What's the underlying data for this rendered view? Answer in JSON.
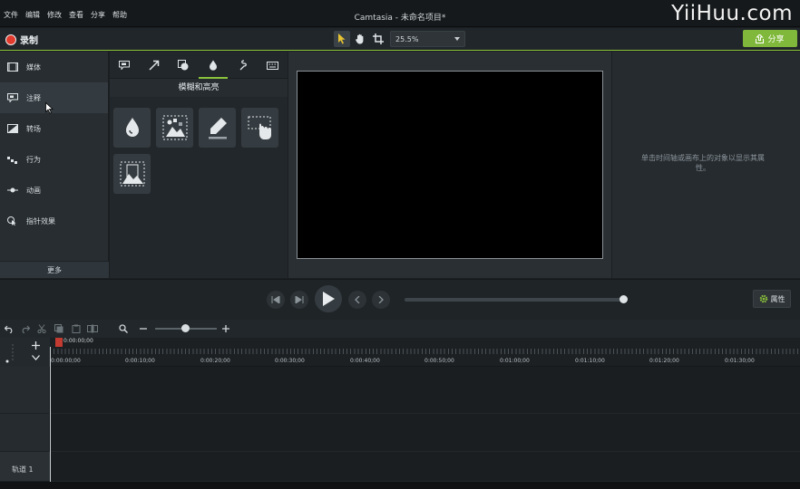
{
  "menu": [
    "文件",
    "编辑",
    "修改",
    "查看",
    "分享",
    "帮助"
  ],
  "app_title": "Camtasia - 未命名项目*",
  "watermark": "YiiHuu.com",
  "toolbar": {
    "record_label": "录制",
    "zoom_value": "25.5%",
    "share_label": "分享"
  },
  "sidebar": {
    "items": [
      {
        "label": "媒体",
        "icon": "film-icon"
      },
      {
        "label": "注释",
        "icon": "annotation-icon"
      },
      {
        "label": "转场",
        "icon": "transition-icon"
      },
      {
        "label": "行为",
        "icon": "behavior-icon"
      },
      {
        "label": "动画",
        "icon": "animation-icon"
      },
      {
        "label": "指针效果",
        "icon": "cursor-effect-icon"
      }
    ],
    "more_label": "更多",
    "active_index": 1
  },
  "panel": {
    "title": "模糊和高亮",
    "tabs": [
      "callout-icon",
      "arrow-icon",
      "shape-icon",
      "blur-icon",
      "sketch-icon",
      "keyboard-icon"
    ],
    "active_tab": 3,
    "tiles": [
      "blur-drop-icon",
      "pixelate-icon",
      "highlight-icon",
      "spotlight-icon",
      "mask-icon"
    ]
  },
  "properties": {
    "hint": "单击时间轴或画布上的对象以显示其属性。",
    "button_label": "属性"
  },
  "timeline": {
    "playhead_time": "0:00:00;00",
    "ruler_labels": [
      "0:00:00;00",
      "0:00:10;00",
      "0:00:20;00",
      "0:00:30;00",
      "0:00:40;00",
      "0:00:50;00",
      "0:01:00;00",
      "0:01:10;00",
      "0:01:20;00",
      "0:01:30;00"
    ],
    "track_label": "轨道 1"
  },
  "colors": {
    "accent": "#8cc43a",
    "record": "#e23a2d",
    "share": "#7fb83a"
  }
}
